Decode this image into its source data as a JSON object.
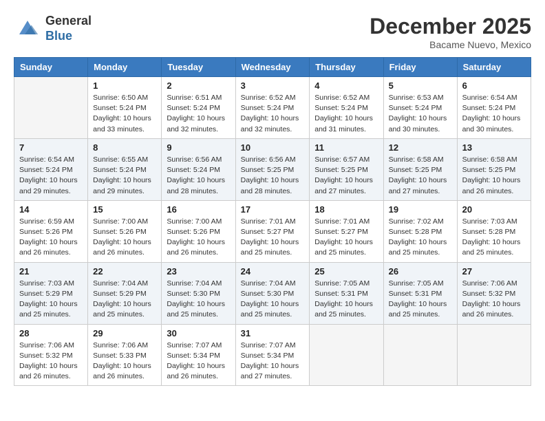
{
  "header": {
    "logo_line1": "General",
    "logo_line2": "Blue",
    "month": "December 2025",
    "location": "Bacame Nuevo, Mexico"
  },
  "days_of_week": [
    "Sunday",
    "Monday",
    "Tuesday",
    "Wednesday",
    "Thursday",
    "Friday",
    "Saturday"
  ],
  "weeks": [
    [
      {
        "day": "",
        "info": ""
      },
      {
        "day": "1",
        "info": "Sunrise: 6:50 AM\nSunset: 5:24 PM\nDaylight: 10 hours\nand 33 minutes."
      },
      {
        "day": "2",
        "info": "Sunrise: 6:51 AM\nSunset: 5:24 PM\nDaylight: 10 hours\nand 32 minutes."
      },
      {
        "day": "3",
        "info": "Sunrise: 6:52 AM\nSunset: 5:24 PM\nDaylight: 10 hours\nand 32 minutes."
      },
      {
        "day": "4",
        "info": "Sunrise: 6:52 AM\nSunset: 5:24 PM\nDaylight: 10 hours\nand 31 minutes."
      },
      {
        "day": "5",
        "info": "Sunrise: 6:53 AM\nSunset: 5:24 PM\nDaylight: 10 hours\nand 30 minutes."
      },
      {
        "day": "6",
        "info": "Sunrise: 6:54 AM\nSunset: 5:24 PM\nDaylight: 10 hours\nand 30 minutes."
      }
    ],
    [
      {
        "day": "7",
        "info": "Sunrise: 6:54 AM\nSunset: 5:24 PM\nDaylight: 10 hours\nand 29 minutes."
      },
      {
        "day": "8",
        "info": "Sunrise: 6:55 AM\nSunset: 5:24 PM\nDaylight: 10 hours\nand 29 minutes."
      },
      {
        "day": "9",
        "info": "Sunrise: 6:56 AM\nSunset: 5:24 PM\nDaylight: 10 hours\nand 28 minutes."
      },
      {
        "day": "10",
        "info": "Sunrise: 6:56 AM\nSunset: 5:25 PM\nDaylight: 10 hours\nand 28 minutes."
      },
      {
        "day": "11",
        "info": "Sunrise: 6:57 AM\nSunset: 5:25 PM\nDaylight: 10 hours\nand 27 minutes."
      },
      {
        "day": "12",
        "info": "Sunrise: 6:58 AM\nSunset: 5:25 PM\nDaylight: 10 hours\nand 27 minutes."
      },
      {
        "day": "13",
        "info": "Sunrise: 6:58 AM\nSunset: 5:25 PM\nDaylight: 10 hours\nand 26 minutes."
      }
    ],
    [
      {
        "day": "14",
        "info": "Sunrise: 6:59 AM\nSunset: 5:26 PM\nDaylight: 10 hours\nand 26 minutes."
      },
      {
        "day": "15",
        "info": "Sunrise: 7:00 AM\nSunset: 5:26 PM\nDaylight: 10 hours\nand 26 minutes."
      },
      {
        "day": "16",
        "info": "Sunrise: 7:00 AM\nSunset: 5:26 PM\nDaylight: 10 hours\nand 26 minutes."
      },
      {
        "day": "17",
        "info": "Sunrise: 7:01 AM\nSunset: 5:27 PM\nDaylight: 10 hours\nand 25 minutes."
      },
      {
        "day": "18",
        "info": "Sunrise: 7:01 AM\nSunset: 5:27 PM\nDaylight: 10 hours\nand 25 minutes."
      },
      {
        "day": "19",
        "info": "Sunrise: 7:02 AM\nSunset: 5:28 PM\nDaylight: 10 hours\nand 25 minutes."
      },
      {
        "day": "20",
        "info": "Sunrise: 7:03 AM\nSunset: 5:28 PM\nDaylight: 10 hours\nand 25 minutes."
      }
    ],
    [
      {
        "day": "21",
        "info": "Sunrise: 7:03 AM\nSunset: 5:29 PM\nDaylight: 10 hours\nand 25 minutes."
      },
      {
        "day": "22",
        "info": "Sunrise: 7:04 AM\nSunset: 5:29 PM\nDaylight: 10 hours\nand 25 minutes."
      },
      {
        "day": "23",
        "info": "Sunrise: 7:04 AM\nSunset: 5:30 PM\nDaylight: 10 hours\nand 25 minutes."
      },
      {
        "day": "24",
        "info": "Sunrise: 7:04 AM\nSunset: 5:30 PM\nDaylight: 10 hours\nand 25 minutes."
      },
      {
        "day": "25",
        "info": "Sunrise: 7:05 AM\nSunset: 5:31 PM\nDaylight: 10 hours\nand 25 minutes."
      },
      {
        "day": "26",
        "info": "Sunrise: 7:05 AM\nSunset: 5:31 PM\nDaylight: 10 hours\nand 25 minutes."
      },
      {
        "day": "27",
        "info": "Sunrise: 7:06 AM\nSunset: 5:32 PM\nDaylight: 10 hours\nand 26 minutes."
      }
    ],
    [
      {
        "day": "28",
        "info": "Sunrise: 7:06 AM\nSunset: 5:32 PM\nDaylight: 10 hours\nand 26 minutes."
      },
      {
        "day": "29",
        "info": "Sunrise: 7:06 AM\nSunset: 5:33 PM\nDaylight: 10 hours\nand 26 minutes."
      },
      {
        "day": "30",
        "info": "Sunrise: 7:07 AM\nSunset: 5:34 PM\nDaylight: 10 hours\nand 26 minutes."
      },
      {
        "day": "31",
        "info": "Sunrise: 7:07 AM\nSunset: 5:34 PM\nDaylight: 10 hours\nand 27 minutes."
      },
      {
        "day": "",
        "info": ""
      },
      {
        "day": "",
        "info": ""
      },
      {
        "day": "",
        "info": ""
      }
    ]
  ]
}
